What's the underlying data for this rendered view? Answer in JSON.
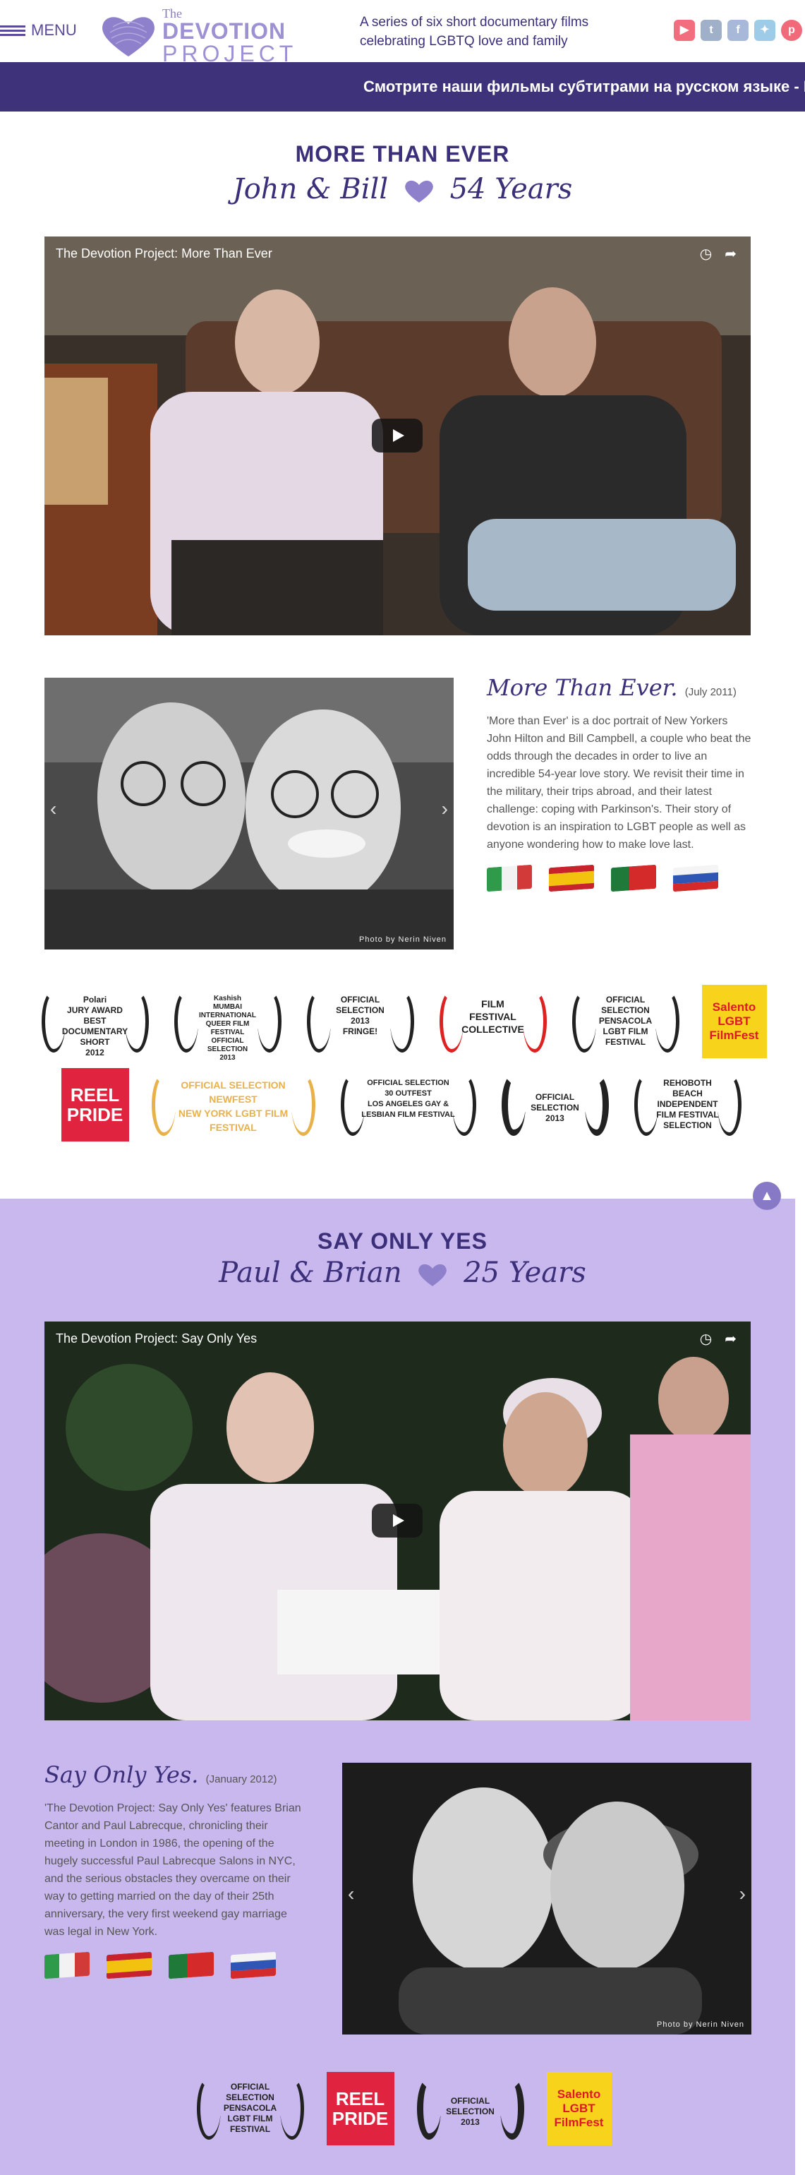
{
  "header": {
    "menu_label": "MENU",
    "logo": {
      "the": "The",
      "devotion": "DEVOTION",
      "project": "PROJECT"
    },
    "tagline": "A series of six short documentary films celebrating LGBTQ love and family",
    "social": [
      {
        "name": "youtube-icon",
        "glyph": "▶"
      },
      {
        "name": "tumblr-icon",
        "glyph": "t"
      },
      {
        "name": "facebook-icon",
        "glyph": "f"
      },
      {
        "name": "twitter-icon",
        "glyph": "✦"
      },
      {
        "name": "pinterest-icon",
        "glyph": "p"
      }
    ]
  },
  "banner": {
    "text": "Смотрите наши фильмы субтитрами на русском языке - П"
  },
  "films": [
    {
      "title": "MORE THAN EVER",
      "names": "John & Bill",
      "years": "54 Years",
      "video_title": "The Devotion Project: More Than Ever",
      "desc_head": "More Than Ever.",
      "desc_date": "(July 2011)",
      "desc_text": "'More than Ever' is a doc portrait of New Yorkers John Hilton and Bill Campbell, a couple who beat the odds through the decades in order to live an incredible 54-year love story. We revisit their time in the military, their trips abroad, and their latest challenge: coping with Parkinson's. Their story of devotion is an inspiration to LGBT people as well as anyone wondering how to make love last.",
      "photo_credit": "Photo by Nerin Niven",
      "laurels_row1": [
        {
          "kind": "laurel",
          "text": "Polari\nJURY AWARD\nBEST DOCUMENTARY\nSHORT\n2012"
        },
        {
          "kind": "laurel",
          "text": "Kashish\nMUMBAI INTERNATIONAL QUEER FILM FESTIVAL\nOFFICIAL\nSELECTION\n2013"
        },
        {
          "kind": "laurel",
          "text": "OFFICIAL SELECTION\n2013\nFRINGE!"
        },
        {
          "kind": "laurel",
          "text": "FILM\nFESTIVAL\nCOLLECTIVE"
        },
        {
          "kind": "laurel",
          "text": "OFFICIAL SELECTION\nPENSACOLA\nLGBT FILM FESTIVAL"
        },
        {
          "kind": "yellow",
          "text": "Salento\nLGBT\nFilmFest"
        }
      ],
      "laurels_row2": [
        {
          "kind": "red",
          "text": "REEL\nPRIDE"
        },
        {
          "kind": "laurel",
          "text": "OFFICIAL SELECTION\nNEWFEST\nNEW YORK LGBT FILM FESTIVAL"
        },
        {
          "kind": "laurel",
          "text": "OFFICIAL SELECTION\n30 OUTFEST\nLOS ANGELES GAY & LESBIAN FILM FESTIVAL"
        },
        {
          "kind": "laurel",
          "text": "OFFICIAL SELECTION\n2013"
        },
        {
          "kind": "laurel",
          "text": "REHOBOTH BEACH\nINDEPENDENT\nFILM FESTIVAL\nSELECTION"
        }
      ]
    },
    {
      "title": "SAY ONLY YES",
      "names": "Paul & Brian",
      "years": "25 Years",
      "video_title": "The Devotion Project: Say Only Yes",
      "desc_head": "Say Only Yes.",
      "desc_date": "(January 2012)",
      "desc_text": "'The Devotion Project: Say Only Yes' features Brian Cantor and Paul Labrecque, chronicling their meeting in London in 1986, the opening of the hugely successful Paul Labrecque Salons in NYC, and the serious obstacles they overcame on their way to getting married on the day of their 25th anniversary, the very first weekend gay marriage was legal in New York.",
      "photo_credit": "Photo by Nerin Niven",
      "laurels_row1": [
        {
          "kind": "laurel",
          "text": "OFFICIAL SELECTION\nPENSACOLA\nLGBT FILM FESTIVAL"
        },
        {
          "kind": "red",
          "text": "REEL\nPRIDE"
        },
        {
          "kind": "laurel",
          "text": "OFFICIAL SELECTION\n2013"
        },
        {
          "kind": "yellow",
          "text": "Salento\nLGBT\nFilmFest"
        }
      ]
    }
  ],
  "colors": {
    "accent": "#3b2f7a",
    "banner": "#3e327a",
    "lavender": "#c9b8ee",
    "logo": "#9d91d3"
  }
}
